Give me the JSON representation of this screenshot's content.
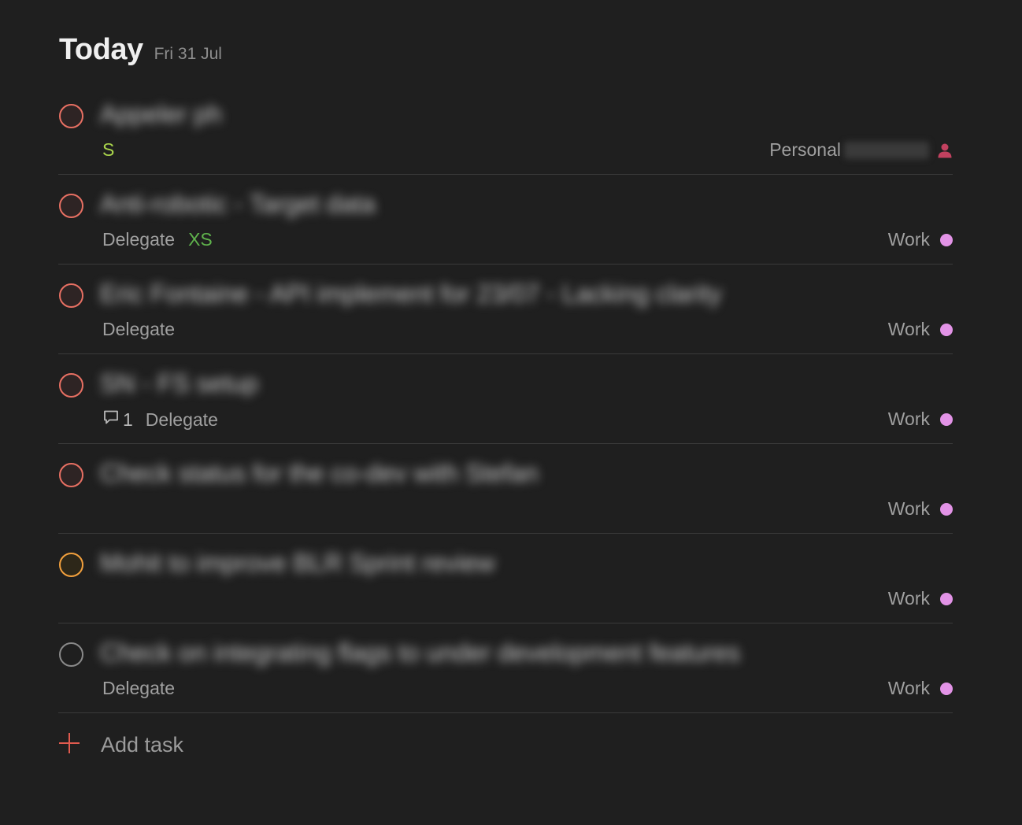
{
  "header": {
    "title": "Today",
    "date": "Fri 31 Jul"
  },
  "tasks": [
    {
      "title": "Appeler ph",
      "meta": {
        "size": "S"
      },
      "project": "Personal",
      "priority": "p1"
    },
    {
      "title": "Anti-robotic - Target data",
      "meta": {
        "label": "Delegate",
        "size": "XS"
      },
      "project": "Work",
      "priority": "p1"
    },
    {
      "title": "Eric Fontaine - API implement for 23/07 - Lacking clarity",
      "meta": {
        "label": "Delegate"
      },
      "project": "Work",
      "priority": "p1"
    },
    {
      "title": "SN - FS setup",
      "meta": {
        "comments": "1",
        "label": "Delegate"
      },
      "project": "Work",
      "priority": "p1"
    },
    {
      "title": "Check status for the co-dev with Stefan",
      "meta": {},
      "project": "Work",
      "priority": "p1"
    },
    {
      "title": "Mohit to improve BLR Sprint review",
      "meta": {},
      "project": "Work",
      "priority": "p2"
    },
    {
      "title": "Check on integrating flags to under development features",
      "meta": {
        "label": "Delegate"
      },
      "project": "Work",
      "priority": "p4"
    }
  ],
  "add_task": {
    "label": "Add task"
  },
  "colors": {
    "background": "#1f1f1f",
    "p1": "#e87063",
    "p2": "#f2a03d",
    "p4": "#8a8a8a",
    "work_dot": "#e293e6",
    "accent": "#e05a4e"
  },
  "icons": {
    "comment": "speech-bubble-icon",
    "person": "person-icon",
    "add": "plus-icon"
  }
}
